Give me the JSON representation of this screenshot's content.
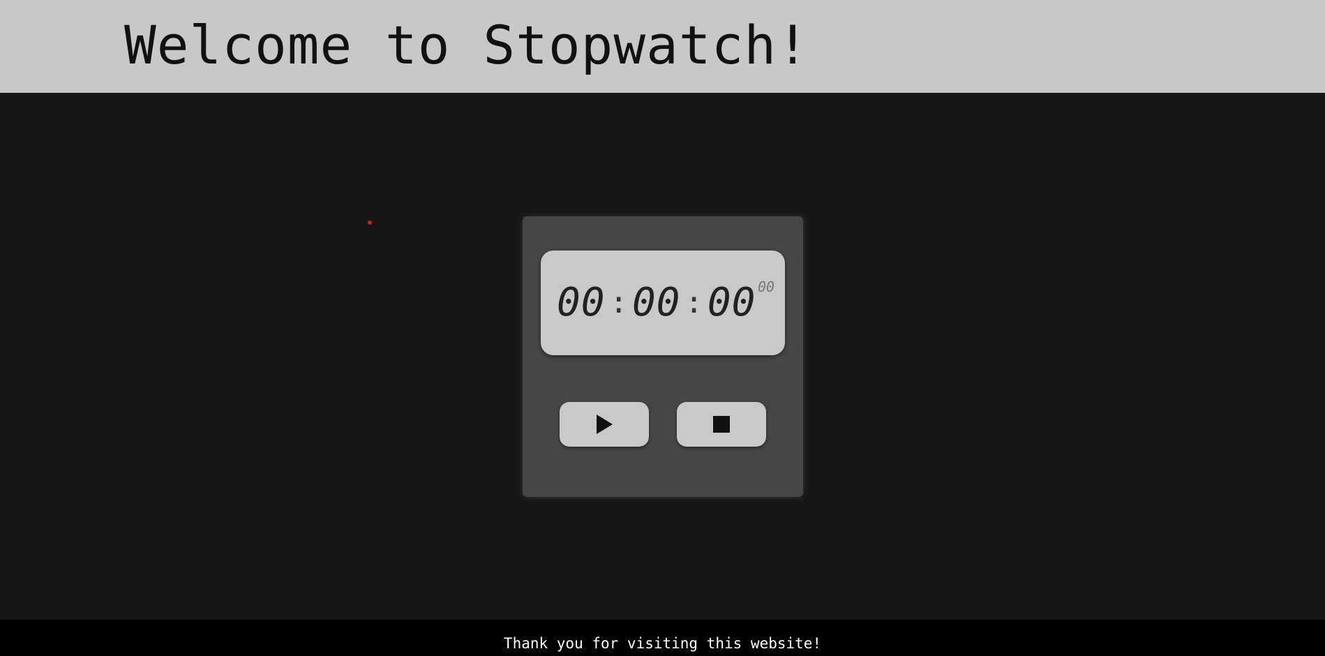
{
  "header": {
    "title": "Welcome to Stopwatch!"
  },
  "stopwatch": {
    "hours": "00",
    "minutes": "00",
    "seconds": "00",
    "separator": ":",
    "centiseconds": "00",
    "play_icon": "play-icon",
    "stop_icon": "stop-icon"
  },
  "footer": {
    "text": "Thank you for visiting this website!"
  },
  "colors": {
    "header_bg": "#c8c8c8",
    "page_bg": "#161616",
    "panel_bg": "#464646",
    "display_bg": "#c9c9c9",
    "footer_bg": "#000000",
    "cursor_dot": "#d31a1a"
  }
}
